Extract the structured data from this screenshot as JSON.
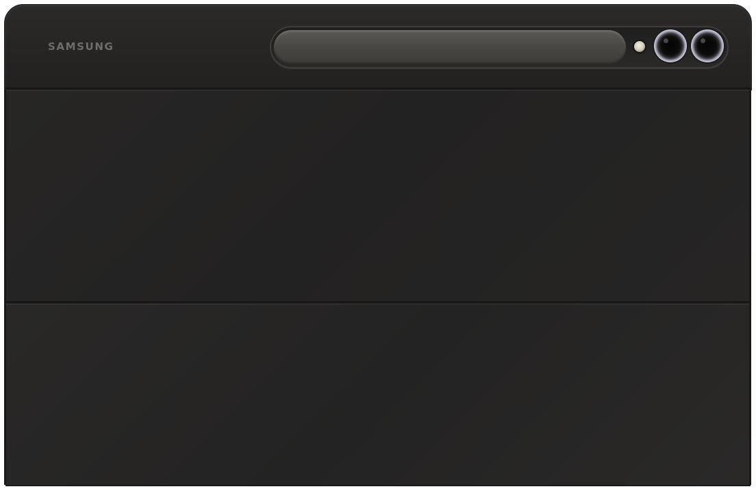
{
  "product": {
    "brand_label": "SAMSUNG"
  },
  "colors": {
    "case": "#252423",
    "brand_text": "#6f6d6b",
    "camera_ring": "#c8c7d6",
    "pen_slot": "#4d4b48"
  }
}
